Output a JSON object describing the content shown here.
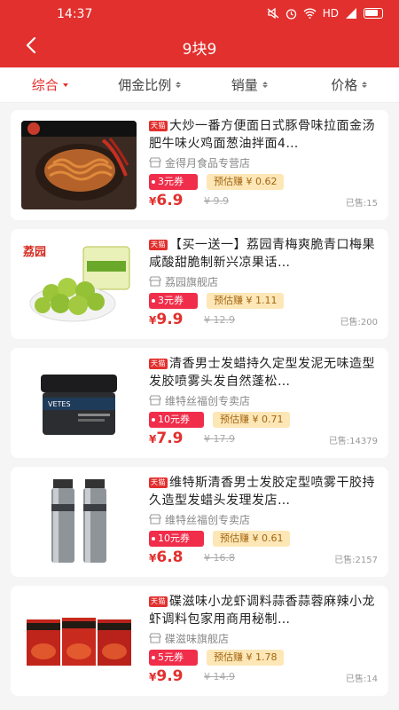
{
  "status": {
    "time": "14:37",
    "network": "HD"
  },
  "nav": {
    "title": "9块9"
  },
  "sort": [
    {
      "label": "综合",
      "active": true
    },
    {
      "label": "佣金比例",
      "active": false
    },
    {
      "label": "销量",
      "active": false
    },
    {
      "label": "价格",
      "active": false
    }
  ],
  "products": [
    {
      "badge": "天猫",
      "title": "大炒一番方便面日式豚骨味拉面金汤肥牛味火鸡面葱油拌面4…",
      "shop": "金得月食品专营店",
      "coupon": "3元券",
      "earn": "预估赚 ¥ 0.62",
      "price_symbol": "¥",
      "price": "6.9",
      "original": "¥ 9.9",
      "sold": "已售:15"
    },
    {
      "badge": "天猫",
      "title": "【买一送一】荔园青梅爽脆青口梅果咸酸甜脆制新兴凉果话…",
      "shop": "荔园旗舰店",
      "coupon": "3元券",
      "earn": "预估赚 ¥ 1.11",
      "price_symbol": "¥",
      "price": "9.9",
      "original": "¥ 12.9",
      "sold": "已售:200"
    },
    {
      "badge": "天猫",
      "title": "清香男士发蜡持久定型发泥无味造型发胶喷雾头发自然蓬松…",
      "shop": "维特丝福创专卖店",
      "coupon": "10元券",
      "earn": "预估赚 ¥ 0.71",
      "price_symbol": "¥",
      "price": "7.9",
      "original": "¥ 17.9",
      "sold": "已售:14379"
    },
    {
      "badge": "天猫",
      "title": "维特斯清香男士发胶定型喷雾干胶持久造型发蜡头发理发店…",
      "shop": "维特丝福创专卖店",
      "coupon": "10元券",
      "earn": "预估赚 ¥ 0.61",
      "price_symbol": "¥",
      "price": "6.8",
      "original": "¥ 16.8",
      "sold": "已售:2157"
    },
    {
      "badge": "天猫",
      "title": "碟滋味小龙虾调料蒜香蒜蓉麻辣小龙虾调料包家用商用秘制…",
      "shop": "碟滋味旗舰店",
      "coupon": "5元券",
      "earn": "预估赚 ¥ 1.78",
      "price_symbol": "¥",
      "price": "9.9",
      "original": "¥ 14.9",
      "sold": "已售:14"
    }
  ],
  "thumb_text": {
    "p2_brand": "荔园",
    "p3_brand": "VETES"
  },
  "colors": {
    "brand_red": "#e2302e",
    "coupon_red": "#f02d4a",
    "earn_bg": "#fde7b7"
  }
}
